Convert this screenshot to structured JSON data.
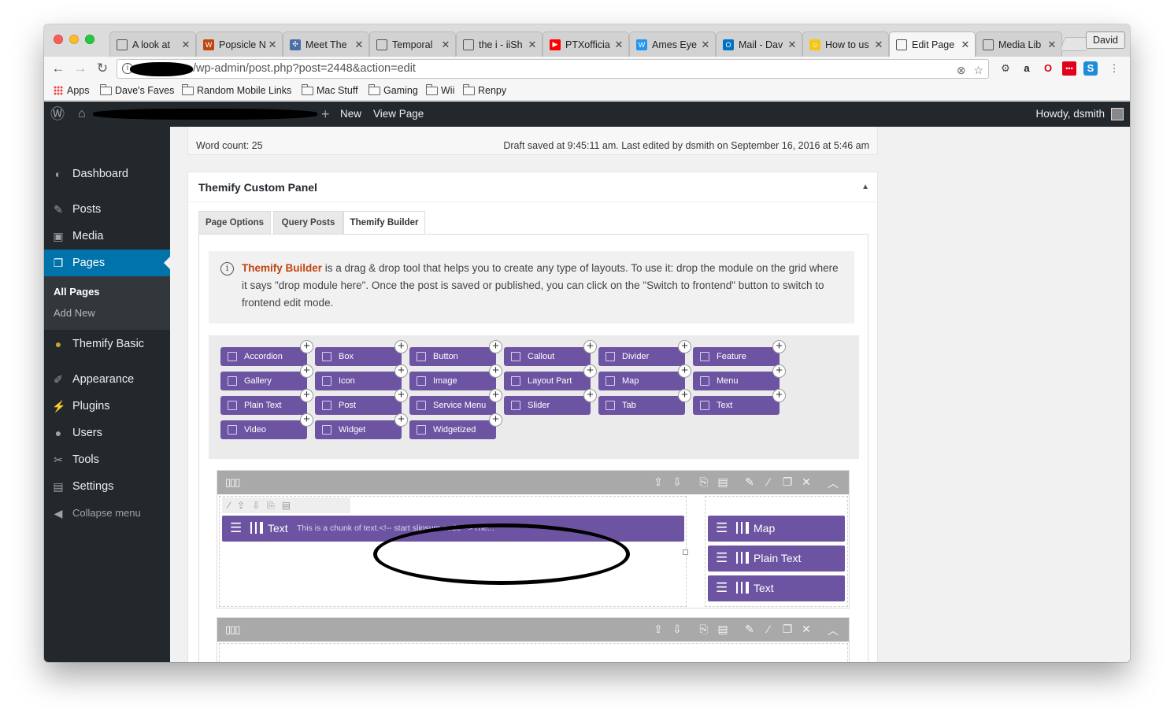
{
  "browser": {
    "tabs": [
      {
        "title": "A look at",
        "icon": "page-icon",
        "color": "#555555"
      },
      {
        "title": "Popsicle N",
        "icon": "wm-favicon",
        "color": "#c1440e"
      },
      {
        "title": "Meet The",
        "icon": "grid-favicon",
        "color": "#4a6fa5"
      },
      {
        "title": "Temporal",
        "icon": "page-icon",
        "color": "#555555"
      },
      {
        "title": "the i - iiSh",
        "icon": "page-icon",
        "color": "#555555"
      },
      {
        "title": "PTXofficia",
        "icon": "youtube-icon",
        "color": "#ff0000"
      },
      {
        "title": "Ames Eye",
        "icon": "wp-favicon",
        "color": "#2196f3"
      },
      {
        "title": "Mail - Dav",
        "icon": "outlook-icon",
        "color": "#0072c6"
      },
      {
        "title": "How to us",
        "icon": "emoji-favicon",
        "color": "#f5c518"
      },
      {
        "title": "Edit Page",
        "icon": "page-icon",
        "color": "#555555",
        "active": true
      },
      {
        "title": "Media Lib",
        "icon": "page-icon",
        "color": "#555555"
      }
    ],
    "profile": "David",
    "url": "/wp-admin/post.php?post=2448&action=edit",
    "bookmarks": [
      "Apps",
      "Dave's Faves",
      "Random Mobile Links",
      "Mac Stuff",
      "Gaming",
      "Wii",
      "Renpy"
    ]
  },
  "adminbar": {
    "new": "New",
    "view_page": "View Page",
    "howdy": "Howdy, dsmith"
  },
  "sidebar": {
    "items": [
      {
        "label": "Dashboard",
        "icon": "dashboard-icon",
        "glyph": "◐"
      },
      {
        "label": "Posts",
        "icon": "pin-icon",
        "glyph": "✎"
      },
      {
        "label": "Media",
        "icon": "media-icon",
        "glyph": "▣"
      },
      {
        "label": "Pages",
        "icon": "pages-icon",
        "glyph": "❐",
        "current": true
      },
      {
        "label": "Themify Basic",
        "icon": "themify-icon",
        "glyph": "●"
      },
      {
        "label": "Appearance",
        "icon": "brush-icon",
        "glyph": "✐"
      },
      {
        "label": "Plugins",
        "icon": "plug-icon",
        "glyph": "⚡"
      },
      {
        "label": "Users",
        "icon": "user-icon",
        "glyph": "●"
      },
      {
        "label": "Tools",
        "icon": "wrench-icon",
        "glyph": "✂"
      },
      {
        "label": "Settings",
        "icon": "settings-icon",
        "glyph": "▤"
      },
      {
        "label": "Collapse menu",
        "icon": "collapse-icon",
        "glyph": "◀"
      }
    ],
    "submenu": [
      "All Pages",
      "Add New"
    ]
  },
  "editor": {
    "word_count": "Word count: 25",
    "draft_status": "Draft saved at 9:45:11 am. Last edited by dsmith on September 16, 2016 at 5:46 am"
  },
  "panel": {
    "title": "Themify Custom Panel",
    "tabs": [
      "Page Options",
      "Query Posts",
      "Themify Builder"
    ],
    "notice_brand": "Themify Builder",
    "notice_text": " is a drag & drop tool that helps you to create any type of layouts. To use it: drop the module on the grid where it says \"drop module here\". Once the post is saved or published, you can click on the \"Switch to frontend\" button to switch to frontend edit mode.",
    "modules": [
      "Accordion",
      "Box",
      "Button",
      "Callout",
      "Divider",
      "Feature",
      "Gallery",
      "Icon",
      "Image",
      "Layout Part",
      "Map",
      "Menu",
      "Plain Text",
      "Post",
      "Service Menu",
      "Slider",
      "Tab",
      "Text",
      "Video",
      "Widget",
      "Widgetized"
    ],
    "row1": {
      "left_module": {
        "name": "Text",
        "excerpt": "This is a chunk of text.<!-- start slipsum code -->The..."
      },
      "right_modules": [
        "Map",
        "Plain Text",
        "Text"
      ]
    }
  },
  "colors": {
    "wp_dark": "#23282d",
    "wp_blue": "#0073aa",
    "builder_purple": "#6d54a3",
    "brand_orange": "#c1440e"
  }
}
